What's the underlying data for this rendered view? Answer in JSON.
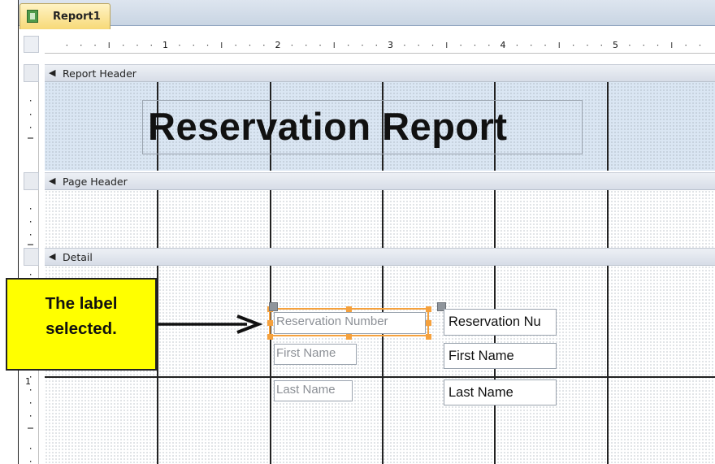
{
  "tab": {
    "title": "Report1",
    "icon": "report-icon"
  },
  "ruler": {
    "numbers": [
      "1",
      "2",
      "3",
      "4",
      "5"
    ]
  },
  "vertical_ruler": {
    "detail_mark": "1"
  },
  "sections": {
    "report_header": {
      "label": "Report Header",
      "icon": "collapse-arrow-icon"
    },
    "page_header": {
      "label": "Page Header",
      "icon": "collapse-arrow-icon"
    },
    "detail": {
      "label": "Detail",
      "icon": "collapse-arrow-icon"
    }
  },
  "report_title": "Reservation Report",
  "controls": {
    "labels": [
      "Reservation Number",
      "First Name",
      "Last Name"
    ],
    "textboxes": [
      "Reservation Nu",
      "First Name",
      "Last Name"
    ]
  },
  "selected_control": "Reservation Number",
  "callout": {
    "line1": "The label",
    "line2": "selected."
  },
  "colors": {
    "selection": "#f5a13d",
    "callout_bg": "#ffff00",
    "header_bg": "#dae6f3"
  }
}
